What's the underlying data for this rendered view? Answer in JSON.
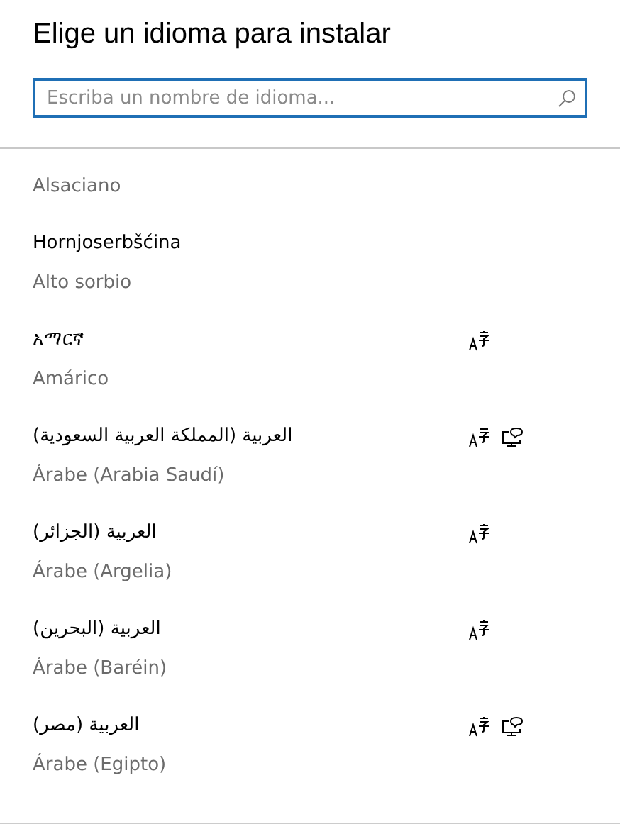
{
  "title": "Elige un idioma para instalar",
  "search": {
    "placeholder": "Escriba un nombre de idioma..."
  },
  "languages": [
    {
      "name": "Alsaciano",
      "text_display": false,
      "speech": false
    },
    {
      "native": "Hornjoserbšćina",
      "name": "Alto sorbio",
      "text_display": false,
      "speech": false
    },
    {
      "native": "አማርኛ",
      "name": "Amárico",
      "text_display": true,
      "speech": false
    },
    {
      "native": "العربية (المملكة العربية السعودية)",
      "name": "Árabe (Arabia Saudí)",
      "text_display": true,
      "speech": true
    },
    {
      "native": "العربية (الجزائر)",
      "name": "Árabe (Argelia)",
      "text_display": true,
      "speech": false
    },
    {
      "native": "العربية (البحرين)",
      "name": "Árabe (Baréin)",
      "text_display": true,
      "speech": false
    },
    {
      "native": "العربية (مصر)",
      "name": "Árabe (Egipto)",
      "text_display": true,
      "speech": true
    }
  ]
}
